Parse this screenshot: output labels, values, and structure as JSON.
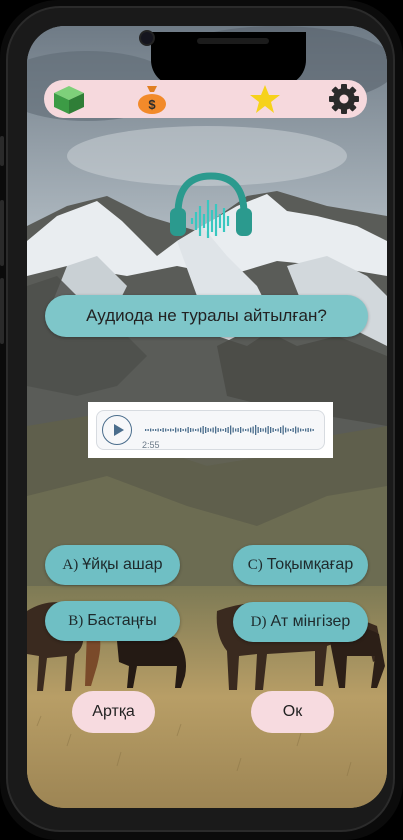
{
  "top_bar": {
    "icons": [
      "cube-icon",
      "money-bag-icon",
      "star-icon",
      "gear-icon"
    ]
  },
  "question": {
    "text": "Аудиода не туралы айтылған?"
  },
  "audio_player": {
    "duration": "2:55",
    "icon": "play-icon"
  },
  "answers": [
    {
      "prefix": "A)",
      "label": "Ұйқы ашар"
    },
    {
      "prefix": "C)",
      "label": "Тоқымқағар"
    },
    {
      "prefix": "B)",
      "label": "Бастаңғы"
    },
    {
      "prefix": "D)",
      "label": "Ат мінгізер"
    }
  ],
  "nav": {
    "back_label": "Артқа",
    "ok_label": "Ок"
  },
  "colors": {
    "pill_pink": "#f7dbe0",
    "teal": "#6fbfc4",
    "headphones": "#2b9a8e"
  }
}
